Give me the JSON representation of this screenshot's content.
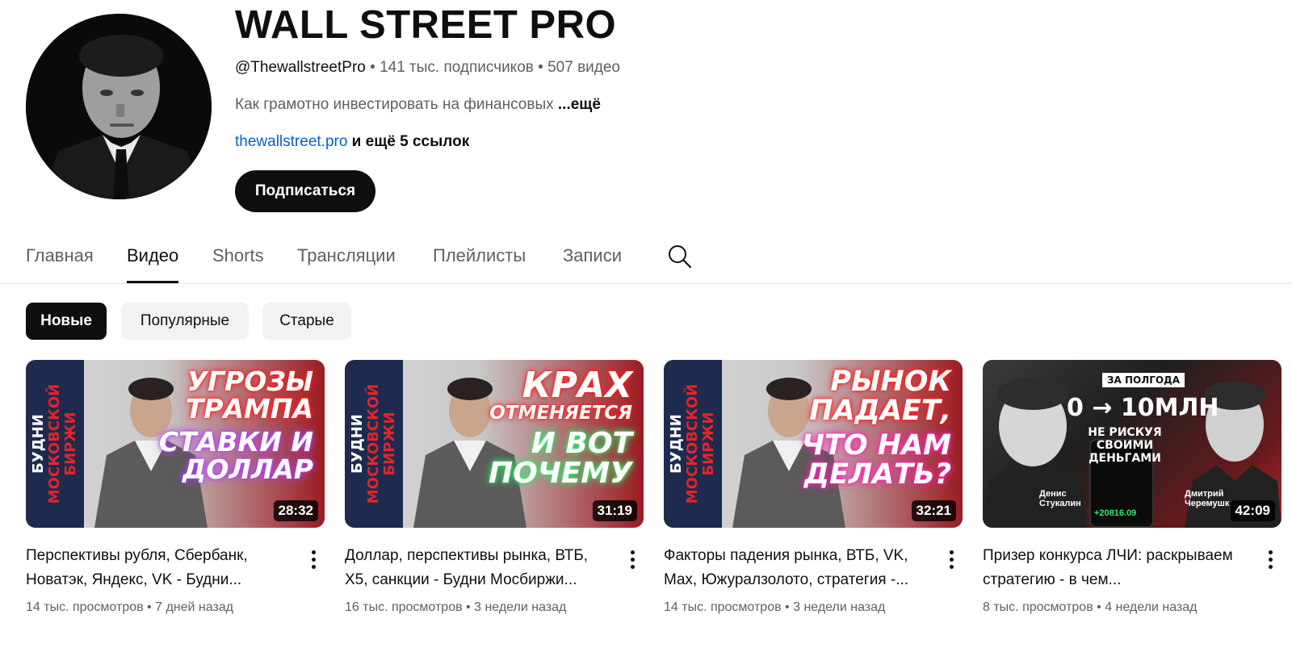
{
  "channel": {
    "name": "WALL STREET PRO",
    "handle": "@ThewallstreetPro",
    "separator": " • ",
    "subscribers": "141 тыс. подписчиков",
    "videos_count": "507 видео",
    "description": "Как грамотно инвестировать на финансовых ",
    "description_more": "...ещё",
    "link": "thewallstreet.pro",
    "more_links": " и ещё 5 ссылок",
    "subscribe_label": "Подписаться"
  },
  "tabs": [
    {
      "label": "Главная"
    },
    {
      "label": "Видео"
    },
    {
      "label": "Shorts"
    },
    {
      "label": "Трансляции"
    },
    {
      "label": "Плейлисты"
    },
    {
      "label": "Записи"
    }
  ],
  "active_tab": "Видео",
  "search_icon": "search-icon",
  "chips": [
    {
      "label": "Новые"
    },
    {
      "label": "Популярные"
    },
    {
      "label": "Старые"
    }
  ],
  "active_chip": "Новые",
  "thumb_series": {
    "line1": "БУДНИ",
    "line2": "МОСКОВСКОЙ",
    "line3": "БИРЖИ"
  },
  "videos": [
    {
      "title": "Перспективы рубля, Сбербанк, Новатэк, Яндекс, VK - Будни...",
      "views": "14 тыс. просмотров",
      "age": "7 дней назад",
      "duration": "28:32",
      "thumb_lines": [
        "УГРОЗЫ",
        "ТРАМПА",
        "СТАВКИ И",
        "ДОЛЛАР"
      ]
    },
    {
      "title": "Доллар, перспективы рынка, ВТБ, X5, санкции - Будни Мосбиржи...",
      "views": "16 тыс. просмотров",
      "age": "3 недели назад",
      "duration": "31:19",
      "thumb_lines": [
        "КРАХ",
        "ОТМЕНЯЕТСЯ",
        "И ВОТ",
        "ПОЧЕМУ"
      ]
    },
    {
      "title": "Факторы падения рынка, ВТБ, VK, Max, Южуралзолото, стратегия -...",
      "views": "14 тыс. просмотров",
      "age": "3 недели назад",
      "duration": "32:21",
      "thumb_lines": [
        "РЫНОК",
        "ПАДАЕТ,",
        "ЧТО НАМ",
        "ДЕЛАТЬ?"
      ]
    },
    {
      "title": "Призер конкурса ЛЧИ: раскрываем стратегию - в чем...",
      "views": "8 тыс. просмотров",
      "age": "4 недели назад",
      "duration": "42:09",
      "thumb_lines": [
        "ЗА ПОЛГОДА",
        "0 → 10МЛН",
        "НЕ РИСКУЯ СВОИМИ",
        "ДЕНЬГАМИ"
      ],
      "thumb_names": [
        "Денис Стукалин",
        "Дмитрий Черемушк"
      ],
      "thumb_amount": "+20816.09"
    }
  ],
  "colors": {
    "text_primary": "#0f0f0f",
    "text_secondary": "#606060",
    "link": "#065fd4",
    "chip_bg": "#f2f2f2",
    "thumb_red": "#e0252b",
    "thumb_green": "#2ee86a",
    "thumb_magenta": "#ff1fb4",
    "thumb_purple": "#b23cff"
  }
}
